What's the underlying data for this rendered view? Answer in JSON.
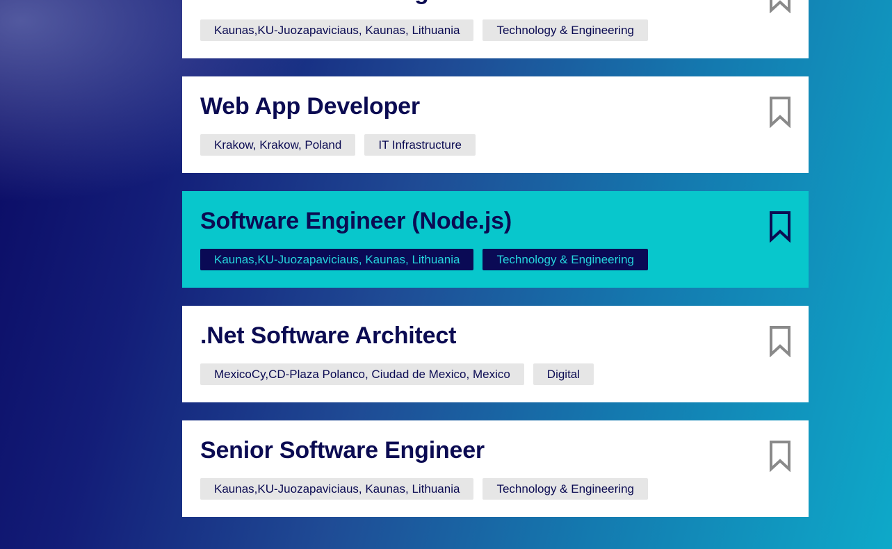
{
  "jobs": [
    {
      "title": "Senior Software Engineer",
      "location": "Kaunas,KU-Juozapaviciaus, Kaunas, Lithuania",
      "category": "Technology & Engineering"
    },
    {
      "title": "Web App Developer",
      "location": "Krakow, Krakow, Poland",
      "category": "IT Infrastructure"
    },
    {
      "title": "Software Engineer (Node.js)",
      "location": "Kaunas,KU-Juozapaviciaus, Kaunas, Lithuania",
      "category": "Technology & Engineering",
      "highlighted": true
    },
    {
      "title": ".Net Software Architect",
      "location": "MexicoCy,CD-Plaza Polanco, Ciudad de Mexico, Mexico",
      "category": "Digital"
    },
    {
      "title": "Senior Software Engineer",
      "location": "Kaunas,KU-Juozapaviciaus, Kaunas, Lithuania",
      "category": "Technology & Engineering"
    }
  ],
  "icons": {
    "save": "bookmark-icon"
  },
  "colors": {
    "title_text": "#0b0b52",
    "tag_background": "#e6e6e6",
    "highlight_background": "#08c7cc",
    "highlight_tag_background": "#0a0a55",
    "highlight_tag_text": "#25d4dc",
    "bookmark_outline": "#8a8a8a",
    "bookmark_outline_active": "#0b0b52"
  }
}
